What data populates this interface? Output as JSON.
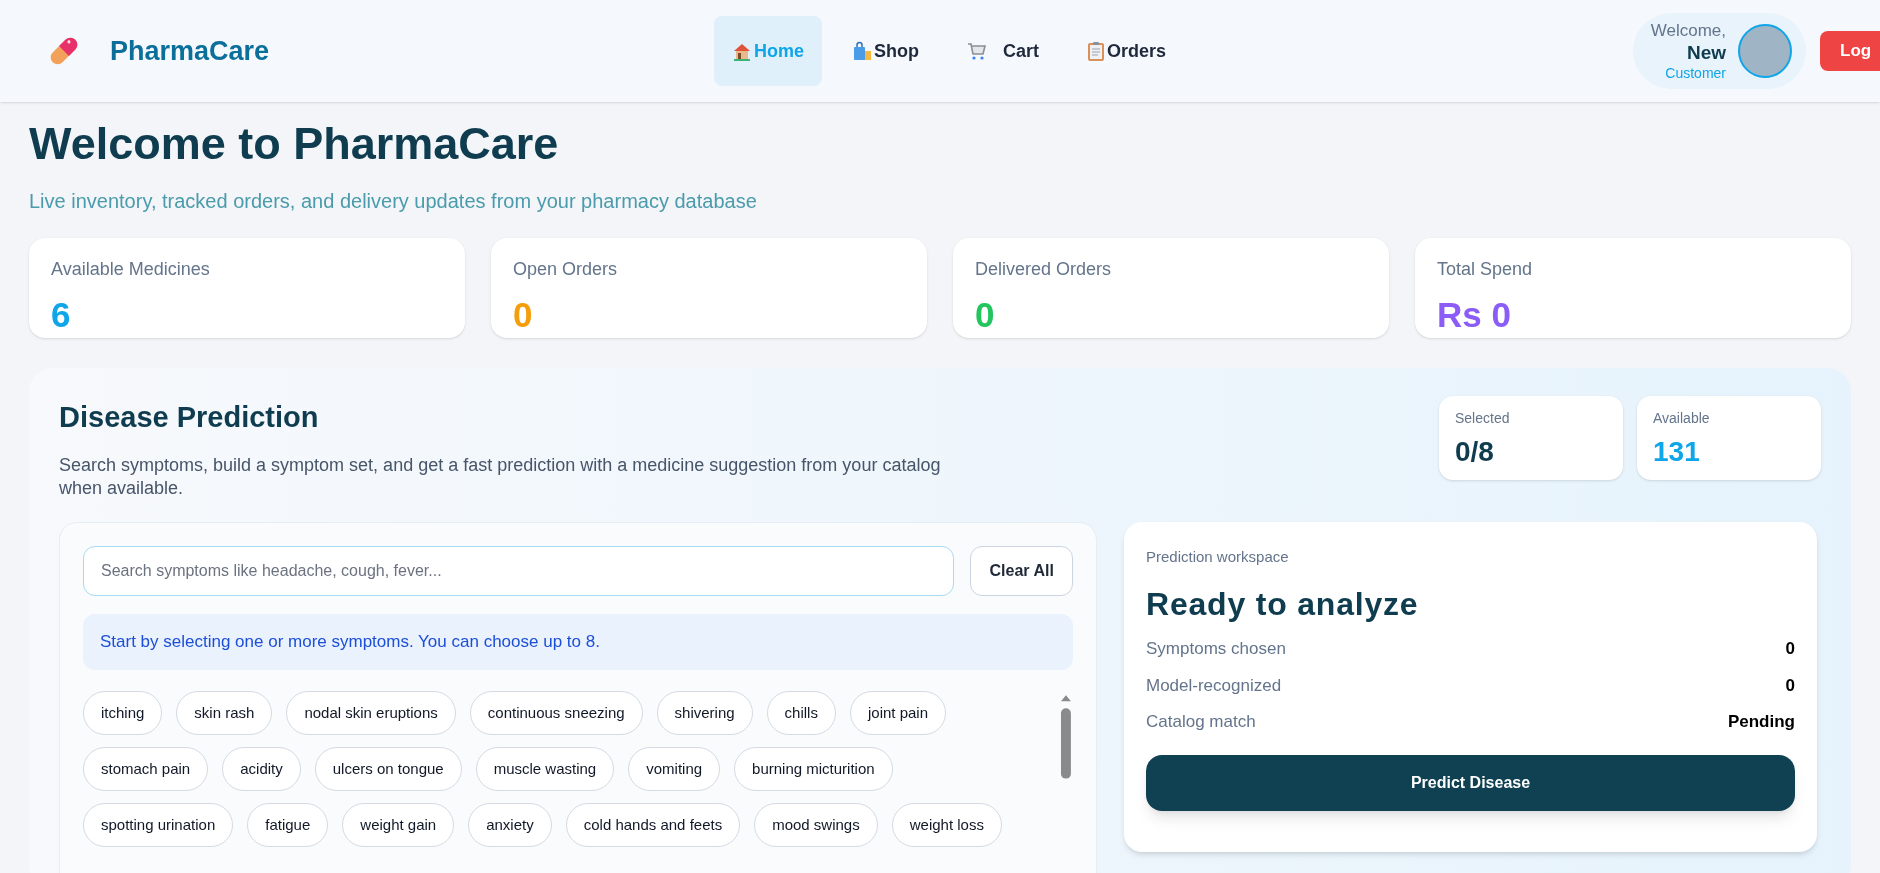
{
  "header": {
    "brand": "PharmaCare",
    "nav": [
      {
        "label": "Home",
        "kind": "home",
        "selected": true
      },
      {
        "label": "Shop",
        "kind": "shop",
        "selected": false
      },
      {
        "label": "Cart",
        "kind": "cart",
        "selected": false
      },
      {
        "label": "Orders",
        "kind": "orders",
        "selected": false
      }
    ],
    "user": {
      "greeting": "Welcome,",
      "name": "New",
      "role": "Customer"
    },
    "logout": "Log"
  },
  "hero": {
    "title": "Welcome to PharmaCare",
    "subtitle": "Live inventory, tracked orders, and delivery updates from your pharmacy database"
  },
  "stats": [
    {
      "label": "Available Medicines",
      "value": "6",
      "color": "#0ea5e9"
    },
    {
      "label": "Open Orders",
      "value": "0",
      "color": "#f59e0b"
    },
    {
      "label": "Delivered Orders",
      "value": "0",
      "color": "#22c55e"
    },
    {
      "label": "Total Spend",
      "value": "Rs 0",
      "color": "#8b5cf6"
    }
  ],
  "prediction": {
    "title": "Disease Prediction",
    "description": "Search symptoms, build a symptom set, and get a fast prediction with a medicine suggestion from your catalog when available.",
    "counters": [
      {
        "label": "Selected",
        "value": "0/8",
        "color": "#0f3d4f"
      },
      {
        "label": "Available",
        "value": "131",
        "color": "#0ea5e9"
      }
    ],
    "search": {
      "placeholder": "Search symptoms like headache, cough, fever..."
    },
    "clear_button": "Clear All",
    "hint": "Start by selecting one or more symptoms. You can choose up to 8.",
    "symptoms": [
      {
        "label": "itching",
        "selected": false
      },
      {
        "label": "skin rash",
        "selected": false
      },
      {
        "label": "nodal skin eruptions",
        "selected": false
      },
      {
        "label": "continuous sneezing",
        "selected": false
      },
      {
        "label": "shivering",
        "selected": false
      },
      {
        "label": "chills",
        "selected": false
      },
      {
        "label": "joint pain",
        "selected": false
      },
      {
        "label": "stomach pain",
        "selected": false
      },
      {
        "label": "acidity",
        "selected": false
      },
      {
        "label": "ulcers on tongue",
        "selected": false
      },
      {
        "label": "muscle wasting",
        "selected": false
      },
      {
        "label": "vomiting",
        "selected": false
      },
      {
        "label": "burning micturition",
        "selected": false
      },
      {
        "label": "spotting urination",
        "selected": false
      },
      {
        "label": "fatigue",
        "selected": false
      },
      {
        "label": "weight gain",
        "selected": false
      },
      {
        "label": "anxiety",
        "selected": false
      },
      {
        "label": "cold hands and feets",
        "selected": false
      },
      {
        "label": "mood swings",
        "selected": false
      },
      {
        "label": "weight loss",
        "selected": false
      }
    ],
    "workspace": {
      "caption": "Prediction workspace",
      "status": "Ready to analyze",
      "rows": [
        {
          "label": "Symptoms chosen",
          "value": "0"
        },
        {
          "label": "Model-recognized",
          "value": "0"
        },
        {
          "label": "Catalog match",
          "value": "Pending"
        }
      ],
      "button": "Predict Disease"
    }
  }
}
